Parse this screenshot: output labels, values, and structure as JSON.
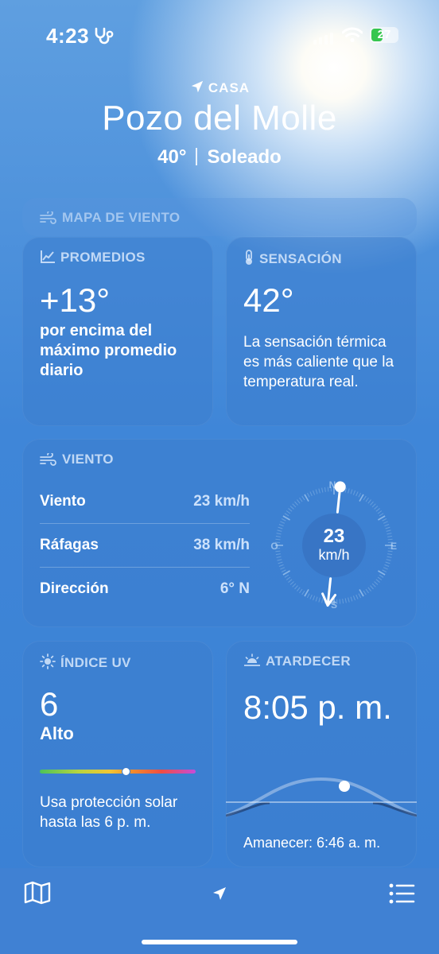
{
  "status": {
    "time": "4:23",
    "battery": "27"
  },
  "location": {
    "label": "CASA",
    "city": "Pozo del Molle",
    "temp": "40°",
    "condition": "Soleado"
  },
  "wind_map": {
    "title": "MAPA DE VIENTO"
  },
  "averages": {
    "title": "PROMEDIOS",
    "value": "+13°",
    "desc": "por encima del máximo promedio diario"
  },
  "feels_like": {
    "title": "SENSACIÓN",
    "value": "42°",
    "desc": "La sensación térmica es más caliente que la temperatura real."
  },
  "wind": {
    "title": "VIENTO",
    "rows": [
      {
        "label": "Viento",
        "value": "23 km/h"
      },
      {
        "label": "Ráfagas",
        "value": "38 km/h"
      },
      {
        "label": "Dirección",
        "value": "6° N"
      }
    ],
    "compass": {
      "speed": "23",
      "unit": "km/h",
      "n": "N",
      "s": "S",
      "e": "E",
      "o": "O",
      "direction_deg": 6
    }
  },
  "uv": {
    "title": "ÍNDICE UV",
    "value": "6",
    "level": "Alto",
    "fraction": 0.55,
    "desc": "Usa protección solar hasta las 6 p. m."
  },
  "sunset": {
    "title": "ATARDECER",
    "time": "8:05 p. m.",
    "sunrise": "Amanecer: 6:46 a. m."
  },
  "colors": {
    "card": "#3c7dcd",
    "uv_dot": "#ffffff"
  }
}
